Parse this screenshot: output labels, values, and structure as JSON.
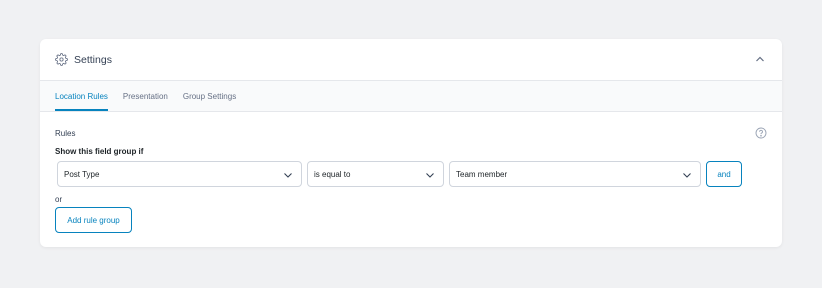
{
  "panel": {
    "title": "Settings",
    "icons": {
      "title_icon": "gear-icon",
      "collapse_icon": "chevron-up-icon"
    }
  },
  "tabs": [
    {
      "label": "Location Rules",
      "active": true
    },
    {
      "label": "Presentation",
      "active": false
    },
    {
      "label": "Group Settings",
      "active": false
    }
  ],
  "rules": {
    "label": "Rules",
    "help_icon": "help-circle-icon",
    "show_if_label": "Show this field group if",
    "param_select": {
      "value": "Post Type"
    },
    "operator_select": {
      "value": "is equal to"
    },
    "value_select": {
      "value": "Team member"
    },
    "and_label": "and",
    "or_label": "or",
    "add_rule_group_label": "Add rule group"
  },
  "colors": {
    "accent": "#0783be",
    "background": "#f0f1f3",
    "panel": "#ffffff"
  }
}
